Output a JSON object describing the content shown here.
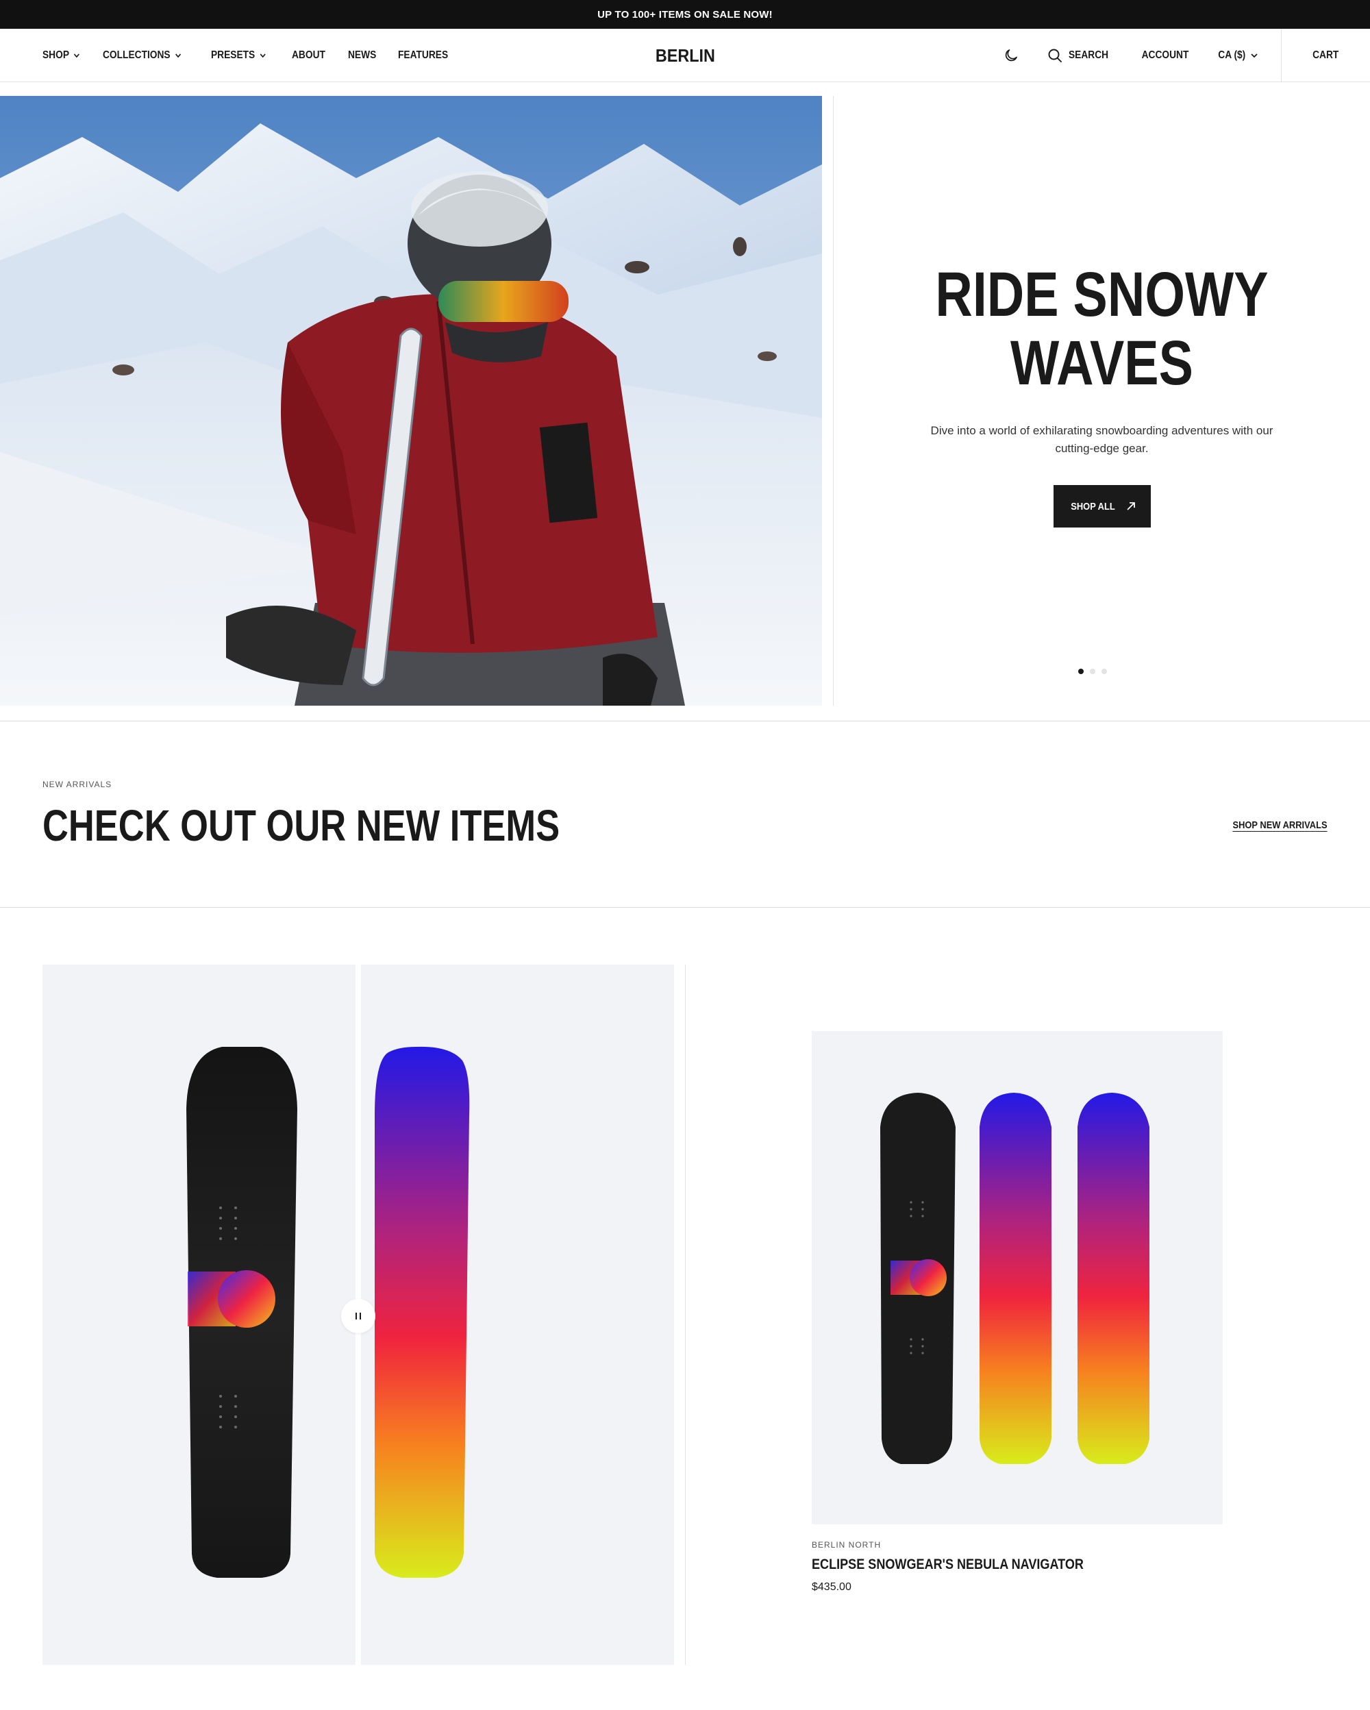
{
  "announcement": "UP TO 100+ ITEMS ON SALE NOW!",
  "header": {
    "logo": "BERLIN",
    "nav": [
      {
        "label": "SHOP",
        "dropdown": true
      },
      {
        "label": "COLLECTIONS",
        "dropdown": true
      },
      {
        "label": "PRESETS",
        "dropdown": true
      },
      {
        "label": "ABOUT",
        "dropdown": false
      },
      {
        "label": "NEWS",
        "dropdown": false
      },
      {
        "label": "FEATURES",
        "dropdown": false
      }
    ],
    "search_label": "SEARCH",
    "account_label": "ACCOUNT",
    "currency_label": "CA ($)",
    "cart_label": "CART"
  },
  "hero": {
    "title_line1": "RIDE SNOWY",
    "title_line2": "WAVES",
    "subtitle": "Dive into a world of exhilarating snowboarding adventures with our cutting-edge gear.",
    "button_label": "SHOP ALL",
    "slides_total": 3,
    "slide_active": 1
  },
  "new_arrivals": {
    "eyebrow": "NEW ARRIVALS",
    "title": "CHECK OUT OUR NEW ITEMS",
    "link_label": "SHOP NEW ARRIVALS"
  },
  "products": [
    {
      "brand": "BERLIN NORTH",
      "name": "ECLIPSE SNOWGEAR'S NEBULA NAVIGATOR",
      "price": "$435.00"
    }
  ],
  "colors": {
    "dark": "#1a1a1a",
    "jacket": "#8e1b24",
    "board_gradient": [
      "#2319e6",
      "#f0243e",
      "#f7811f",
      "#d8ec1c"
    ]
  }
}
